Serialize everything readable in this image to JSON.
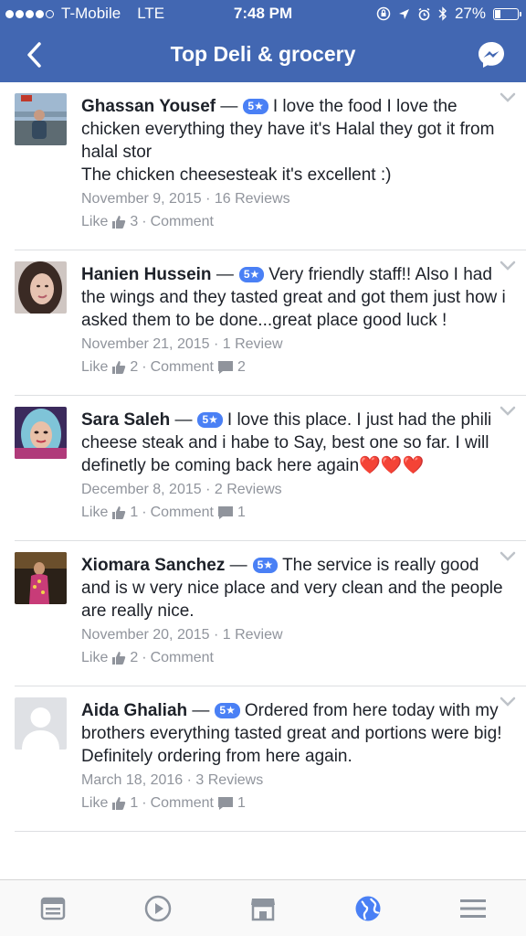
{
  "status_bar": {
    "carrier": "T-Mobile",
    "network": "LTE",
    "time": "7:48 PM",
    "battery_percent": "27%",
    "battery_level": 0.27
  },
  "header": {
    "title": "Top Deli & grocery",
    "back_icon": "chevron-left-icon",
    "messenger_icon": "messenger-icon",
    "background_color": "#4267b2"
  },
  "reviews": [
    {
      "name": "Ghassan Yousef",
      "dash": "—",
      "rating": "5★",
      "text": "I love the food I love the chicken everything they have it's Halal they got it from halal stor\nThe chicken cheesesteak it's excellent :)",
      "date": "November 9, 2015",
      "review_count": "16 Reviews",
      "like_label": "Like",
      "likes": "3",
      "comment_label": "Comment",
      "comments": ""
    },
    {
      "name": "Hanien Hussein",
      "dash": "—",
      "rating": "5★",
      "text": "Very friendly staff!! Also I had the wings and they tasted great and got them just how i asked them to be done...great place good luck !",
      "date": "November 21, 2015",
      "review_count": "1 Review",
      "like_label": "Like",
      "likes": "2",
      "comment_label": "Comment",
      "comments": "2"
    },
    {
      "name": "Sara Saleh",
      "dash": "—",
      "rating": "5★",
      "text": "I love this place. I just had the phili cheese steak and i habe to Say, best one so far. I will definetly be coming back here again❤️❤️❤️",
      "date": "December 8, 2015",
      "review_count": "2 Reviews",
      "like_label": "Like",
      "likes": "1",
      "comment_label": "Comment",
      "comments": "1"
    },
    {
      "name": "Xiomara Sanchez",
      "dash": "—",
      "rating": "5★",
      "text": "The service is really good and is w very nice place and very clean and the people are really nice.",
      "date": "November 20, 2015",
      "review_count": "1 Review",
      "like_label": "Like",
      "likes": "2",
      "comment_label": "Comment",
      "comments": ""
    },
    {
      "name": "Aida Ghaliah",
      "dash": "—",
      "rating": "5★",
      "text": "Ordered from here today with my brothers everything tasted great and portions were big! Definitely ordering from here again.",
      "date": "March 18, 2016",
      "review_count": "3 Reviews",
      "like_label": "Like",
      "likes": "1",
      "comment_label": "Comment",
      "comments": "1"
    }
  ],
  "tabbar": {
    "tabs": [
      "news-feed-icon",
      "video-icon",
      "marketplace-icon",
      "globe-icon",
      "menu-icon"
    ],
    "active_index": 3,
    "active_color": "#4a80f5",
    "inactive_color": "#8d949e"
  }
}
